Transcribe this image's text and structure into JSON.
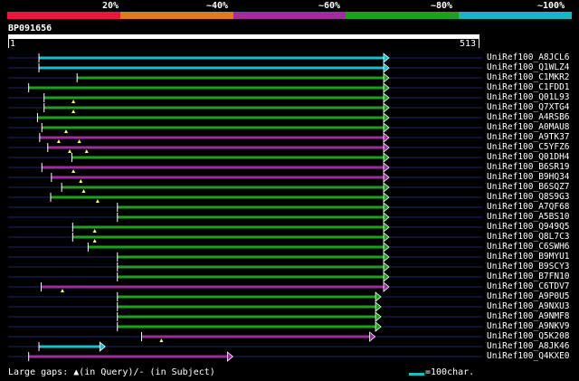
{
  "legend": {
    "labels": [
      "20%",
      "~40%",
      "~60%",
      "~80%",
      "~100%"
    ],
    "colors": [
      "#e8173b",
      "#e07a1f",
      "#9b2f9b",
      "#1f9f1f",
      "#17b6c6"
    ]
  },
  "query": {
    "id": "BP091656",
    "start": "1",
    "end": "513",
    "length": 513
  },
  "hits": [
    {
      "name": "UniRef100_A8JCL6",
      "start": 43,
      "end": 513,
      "color": "#17becf",
      "gaps": []
    },
    {
      "name": "UniRef100_Q1WLZ4",
      "start": 43,
      "end": 513,
      "color": "#17becf",
      "gaps": []
    },
    {
      "name": "UniRef100_C1MKR2",
      "start": 95,
      "end": 513,
      "color": "#1f9f1f",
      "gaps": []
    },
    {
      "name": "UniRef100_C1FDD1",
      "start": 29,
      "end": 513,
      "color": "#1f9f1f",
      "gaps": []
    },
    {
      "name": "UniRef100_Q01L93",
      "start": 50,
      "end": 513,
      "color": "#1f9f1f",
      "gaps": [
        90
      ]
    },
    {
      "name": "UniRef100_Q7XTG4",
      "start": 50,
      "end": 513,
      "color": "#1f9f1f",
      "gaps": [
        90
      ]
    },
    {
      "name": "UniRef100_A4RSB6",
      "start": 41,
      "end": 513,
      "color": "#1f9f1f",
      "gaps": []
    },
    {
      "name": "UniRef100_A0MAU8",
      "start": 47,
      "end": 513,
      "color": "#1f9f1f",
      "gaps": [
        80
      ]
    },
    {
      "name": "UniRef100_A9TK37",
      "start": 44,
      "end": 513,
      "color": "#9b2f9b",
      "gaps": [
        70,
        98
      ]
    },
    {
      "name": "UniRef100_C5YFZ6",
      "start": 55,
      "end": 513,
      "color": "#9b2f9b",
      "gaps": [
        85,
        108
      ]
    },
    {
      "name": "UniRef100_Q01DH4",
      "start": 88,
      "end": 513,
      "color": "#1f9f1f",
      "gaps": []
    },
    {
      "name": "UniRef100_B6SR19",
      "start": 47,
      "end": 513,
      "color": "#9b2f9b",
      "gaps": [
        90
      ]
    },
    {
      "name": "UniRef100_B9HQ34",
      "start": 60,
      "end": 513,
      "color": "#9b2f9b",
      "gaps": [
        100
      ]
    },
    {
      "name": "UniRef100_B6SQZ7",
      "start": 74,
      "end": 513,
      "color": "#1f9f1f",
      "gaps": [
        104
      ]
    },
    {
      "name": "UniRef100_Q8S9G3",
      "start": 59,
      "end": 513,
      "color": "#1f9f1f",
      "gaps": [
        123
      ]
    },
    {
      "name": "UniRef100_A7QF68",
      "start": 150,
      "end": 513,
      "color": "#1f9f1f",
      "gaps": []
    },
    {
      "name": "UniRef100_A5BS10",
      "start": 150,
      "end": 513,
      "color": "#1f9f1f",
      "gaps": []
    },
    {
      "name": "UniRef100_Q949Q5",
      "start": 89,
      "end": 513,
      "color": "#1f9f1f",
      "gaps": [
        119
      ]
    },
    {
      "name": "UniRef100_Q8L7C3",
      "start": 89,
      "end": 513,
      "color": "#1f9f1f",
      "gaps": [
        119
      ]
    },
    {
      "name": "UniRef100_C6SWH6",
      "start": 110,
      "end": 513,
      "color": "#1f9f1f",
      "gaps": []
    },
    {
      "name": "UniRef100_B9MYU1",
      "start": 150,
      "end": 513,
      "color": "#1f9f1f",
      "gaps": []
    },
    {
      "name": "UniRef100_B9SCY3",
      "start": 150,
      "end": 513,
      "color": "#1f9f1f",
      "gaps": []
    },
    {
      "name": "UniRef100_B7FN10",
      "start": 150,
      "end": 513,
      "color": "#1f9f1f",
      "gaps": []
    },
    {
      "name": "UniRef100_C6TDV7",
      "start": 46,
      "end": 513,
      "color": "#9b2f9b",
      "gaps": [
        75
      ]
    },
    {
      "name": "UniRef100_A9P0U5",
      "start": 150,
      "end": 502,
      "color": "#1f9f1f",
      "gaps": []
    },
    {
      "name": "UniRef100_A9NXU3",
      "start": 150,
      "end": 502,
      "color": "#1f9f1f",
      "gaps": []
    },
    {
      "name": "UniRef100_A9NMF8",
      "start": 150,
      "end": 502,
      "color": "#1f9f1f",
      "gaps": []
    },
    {
      "name": "UniRef100_A9NKV9",
      "start": 150,
      "end": 502,
      "color": "#1f9f1f",
      "gaps": []
    },
    {
      "name": "UniRef100_Q5K208",
      "start": 183,
      "end": 494,
      "color": "#9b2f9b",
      "gaps": [
        210
      ]
    },
    {
      "name": "UniRef100_A8JK46",
      "start": 43,
      "end": 126,
      "color": "#17becf",
      "gaps": []
    },
    {
      "name": "UniRef100_Q4KXE0",
      "start": 29,
      "end": 300,
      "color": "#9b2f9b",
      "gaps": []
    }
  ],
  "footer": {
    "gaps_label": "Large gaps: ▲(in Query)/- (in Subject)",
    "scale_label": "=100char."
  }
}
